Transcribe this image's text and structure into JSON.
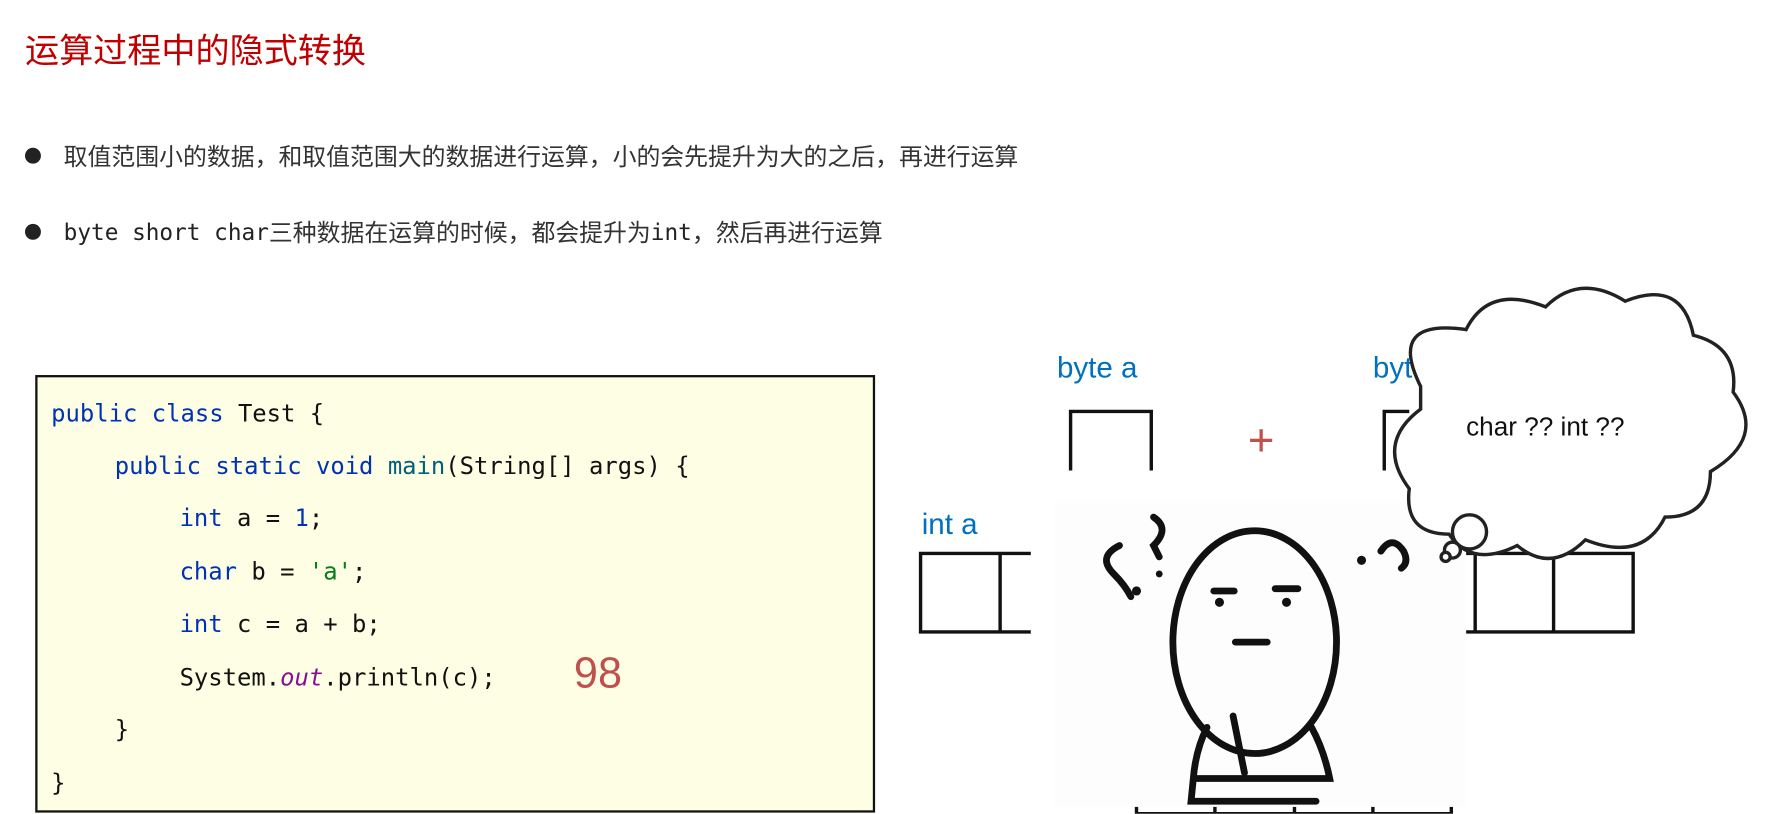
{
  "title": "运算过程中的隐式转换",
  "bullets": [
    {
      "text": "取值范围小的数据，和取值范围大的数据进行运算，小的会先提升为大的之后，再进行运算"
    },
    {
      "code_part": "byte short char",
      "text_a": " 三种数据在运算的时候，都会提升为",
      "code_int": "int",
      "text_b": "，然后再进行运算"
    }
  ],
  "code": {
    "l1_kw": "public class",
    "l1_rest": " Test {",
    "l2_kw": "public static void",
    "l2_fn": "main",
    "l2_rest": "(String[] args) {",
    "l3_kw": "int",
    "l3_rest": " a = ",
    "l3_num": "1",
    "l3_end": ";",
    "l4_kw": "char",
    "l4_rest": " b = ",
    "l4_str": "'a'",
    "l4_end": ";",
    "l5_kw": "int",
    "l5_rest": " c = a + b;",
    "l6_a": "System.",
    "l6_field": "out",
    "l6_b": ".println(c);",
    "l7": "}",
    "l8": "}",
    "output": "98"
  },
  "diagram": {
    "label_byte_a": "byte a",
    "label_byte_b_partial": "byte",
    "plus": "+",
    "label_int_a": "int a",
    "thought": "char ?? int ??"
  },
  "colors": {
    "title": "#c00000",
    "label": "#0070c0",
    "accent_red": "#c0504d",
    "code_bg": "#fefee4"
  }
}
